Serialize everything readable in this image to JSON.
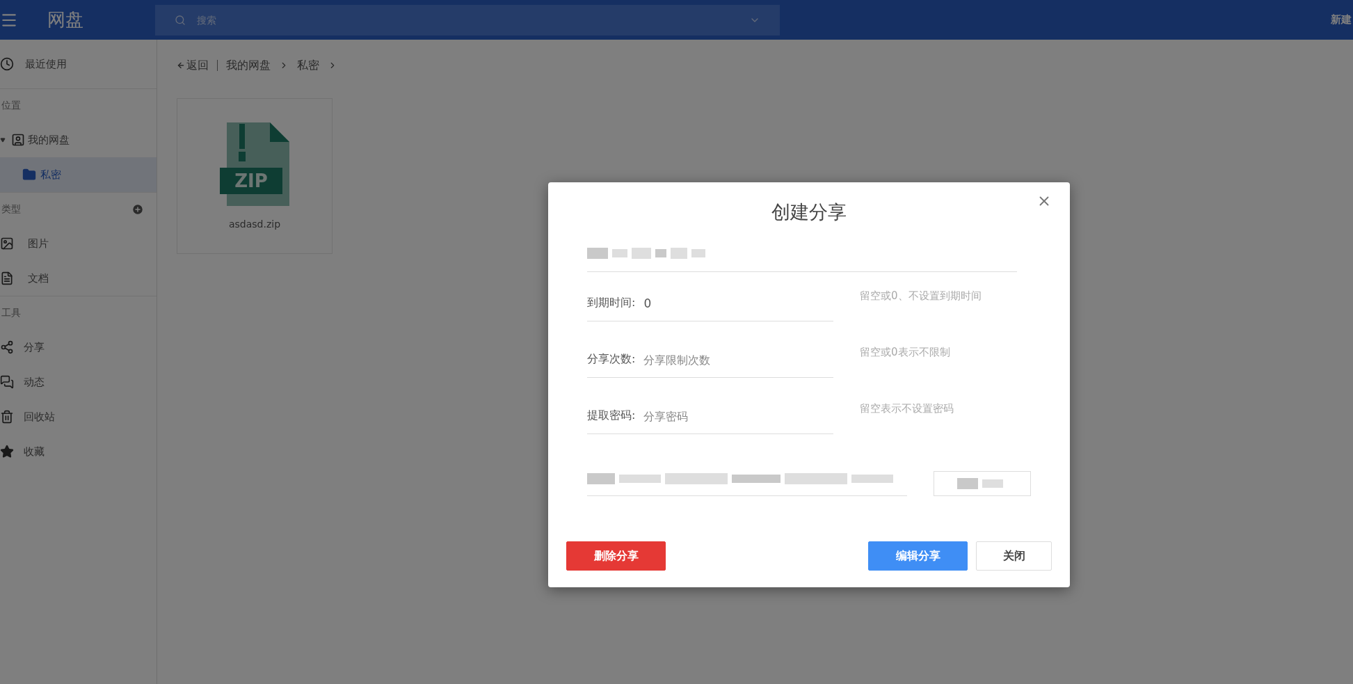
{
  "top_bar": {
    "title": "网盘",
    "search": {
      "placeholder": "搜索"
    },
    "new_button": "新建"
  },
  "sidebar": {
    "recent": {
      "label": "最近使用",
      "selected": false
    },
    "location": {
      "heading": "位置",
      "items": [
        {
          "label": "我的网盘",
          "expanded": true,
          "selected": false,
          "children": [
            {
              "label": "私密",
              "selected": true
            }
          ]
        }
      ]
    },
    "types": {
      "heading": "类型",
      "items": [
        {
          "label": "图片",
          "selected": false
        },
        {
          "label": "文档",
          "selected": false
        }
      ]
    },
    "tools": {
      "heading": "工具",
      "items": [
        {
          "label": "分享",
          "selected": false
        },
        {
          "label": "动态",
          "selected": false
        },
        {
          "label": "回收站",
          "selected": false
        },
        {
          "label": "收藏",
          "selected": false
        }
      ]
    }
  },
  "breadcrumb": {
    "back": "返回",
    "crumbs": [
      "我的网盘",
      "私密"
    ]
  },
  "files": [
    {
      "name": "asdasd.zip",
      "kind": "zip",
      "badge": "ZIP"
    }
  ],
  "dialog": {
    "title": "创建分享",
    "fields": [
      {
        "label": "到期时间:",
        "value": "0",
        "hint": "留空或0、不设置到期时间"
      },
      {
        "label": "分享次数:",
        "placeholder": "分享限制次数",
        "hint": "留空或0表示不限制"
      },
      {
        "label": "提取密码:",
        "placeholder": "分享密码",
        "hint": "留空表示不设置密码"
      }
    ],
    "delete_button": "删除分享",
    "edit_button": "编辑分享",
    "close_button": "关闭"
  }
}
